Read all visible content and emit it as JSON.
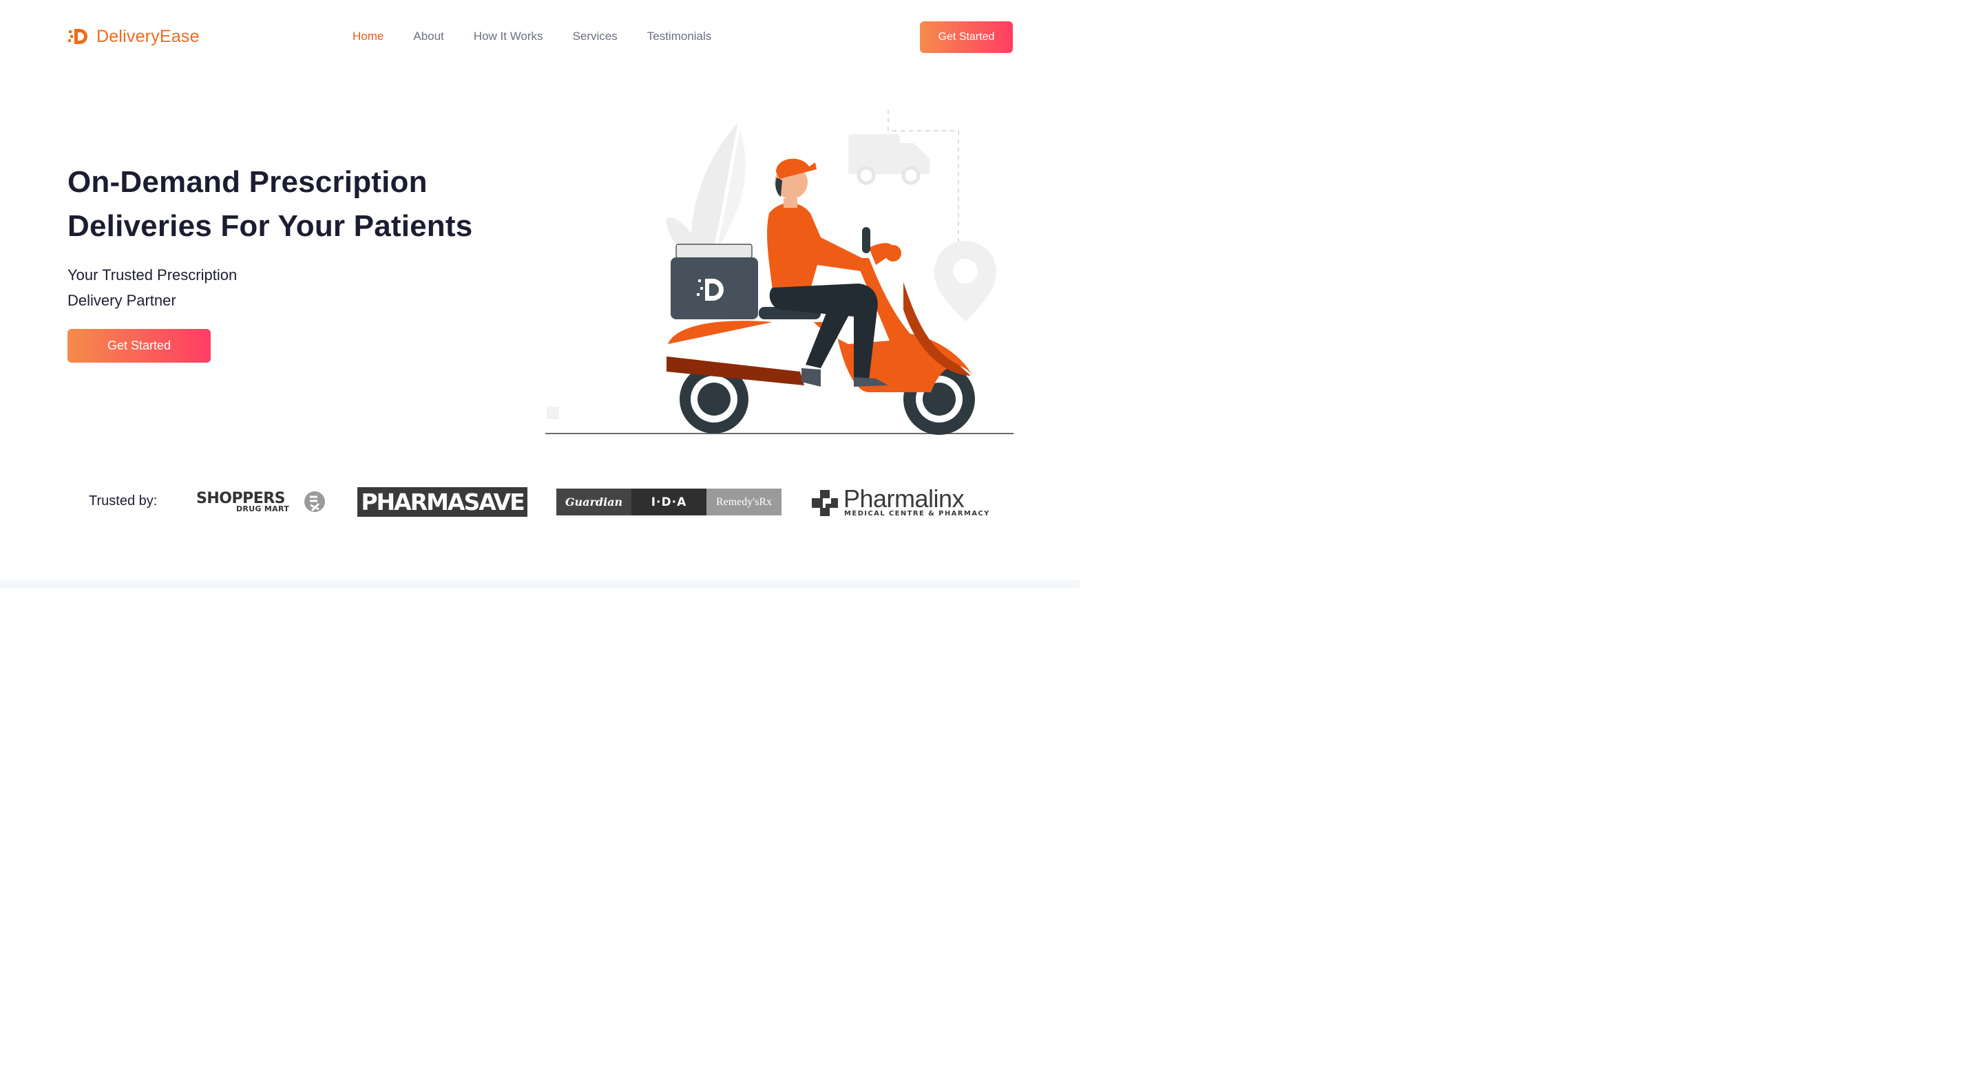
{
  "brand": {
    "name": "DeliveryEase",
    "accent": "#f06a1c"
  },
  "nav": {
    "items": [
      {
        "label": "Home",
        "active": true
      },
      {
        "label": "About",
        "active": false
      },
      {
        "label": "How It Works",
        "active": false
      },
      {
        "label": "Services",
        "active": false
      },
      {
        "label": "Testimonials",
        "active": false
      }
    ],
    "cta_label": "Get Started"
  },
  "hero": {
    "title_line1": "On-Demand Prescription",
    "title_line2": "Deliveries For Your Patients",
    "subtitle_line1": "Your Trusted Prescription",
    "subtitle_line2": "Delivery Partner",
    "cta_label": "Get Started",
    "illustration_icons": [
      "delivery-scooter-icon",
      "delivery-truck-icon",
      "location-pin-icon",
      "leaf-plant-icon"
    ]
  },
  "trusted": {
    "label": "Trusted by:",
    "partners": {
      "shoppers": {
        "name": "SHOPPERS",
        "sub": "DRUG MART"
      },
      "pharmasave": {
        "name": "PHARMASAVE"
      },
      "combo": {
        "a": "Guardian",
        "b": "I·D·A",
        "c": "Remedy'sRx"
      },
      "pharmalinx": {
        "name": "Pharmalinx",
        "sub": "MEDICAL CENTRE & PHARMACY"
      }
    }
  },
  "colors": {
    "gradient_start": "#f58b4b",
    "gradient_end": "#ff3e64",
    "heading": "#1c1d31",
    "nav_text": "#6b6f80"
  }
}
